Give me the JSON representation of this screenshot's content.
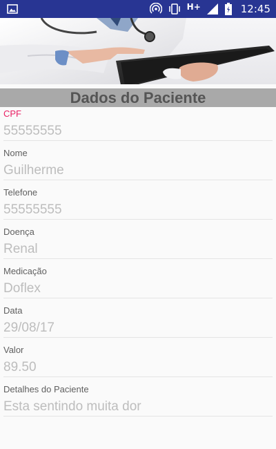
{
  "status_bar": {
    "network": "H+",
    "time": "12:45"
  },
  "page": {
    "title": "Dados do Paciente"
  },
  "fields": [
    {
      "label": "CPF",
      "value": "55555555"
    },
    {
      "label": "Nome",
      "value": "Guilherme"
    },
    {
      "label": "Telefone",
      "value": "55555555"
    },
    {
      "label": "Doença",
      "value": "Renal"
    },
    {
      "label": "Medicação",
      "value": "Doflex"
    },
    {
      "label": "Data",
      "value": "29/08/17"
    },
    {
      "label": "Valor",
      "value": "89.50"
    },
    {
      "label": "Detalhes do Paciente",
      "value": "Esta sentindo muita dor"
    }
  ],
  "colors": {
    "status_bar": "#283593",
    "title_bar": "#a9a9a9",
    "active_label": "#e91e63",
    "value_text": "#bdbdbd"
  },
  "icons": [
    "image-icon",
    "hotspot-icon",
    "vibrate-icon",
    "signal-icon",
    "battery-icon"
  ]
}
